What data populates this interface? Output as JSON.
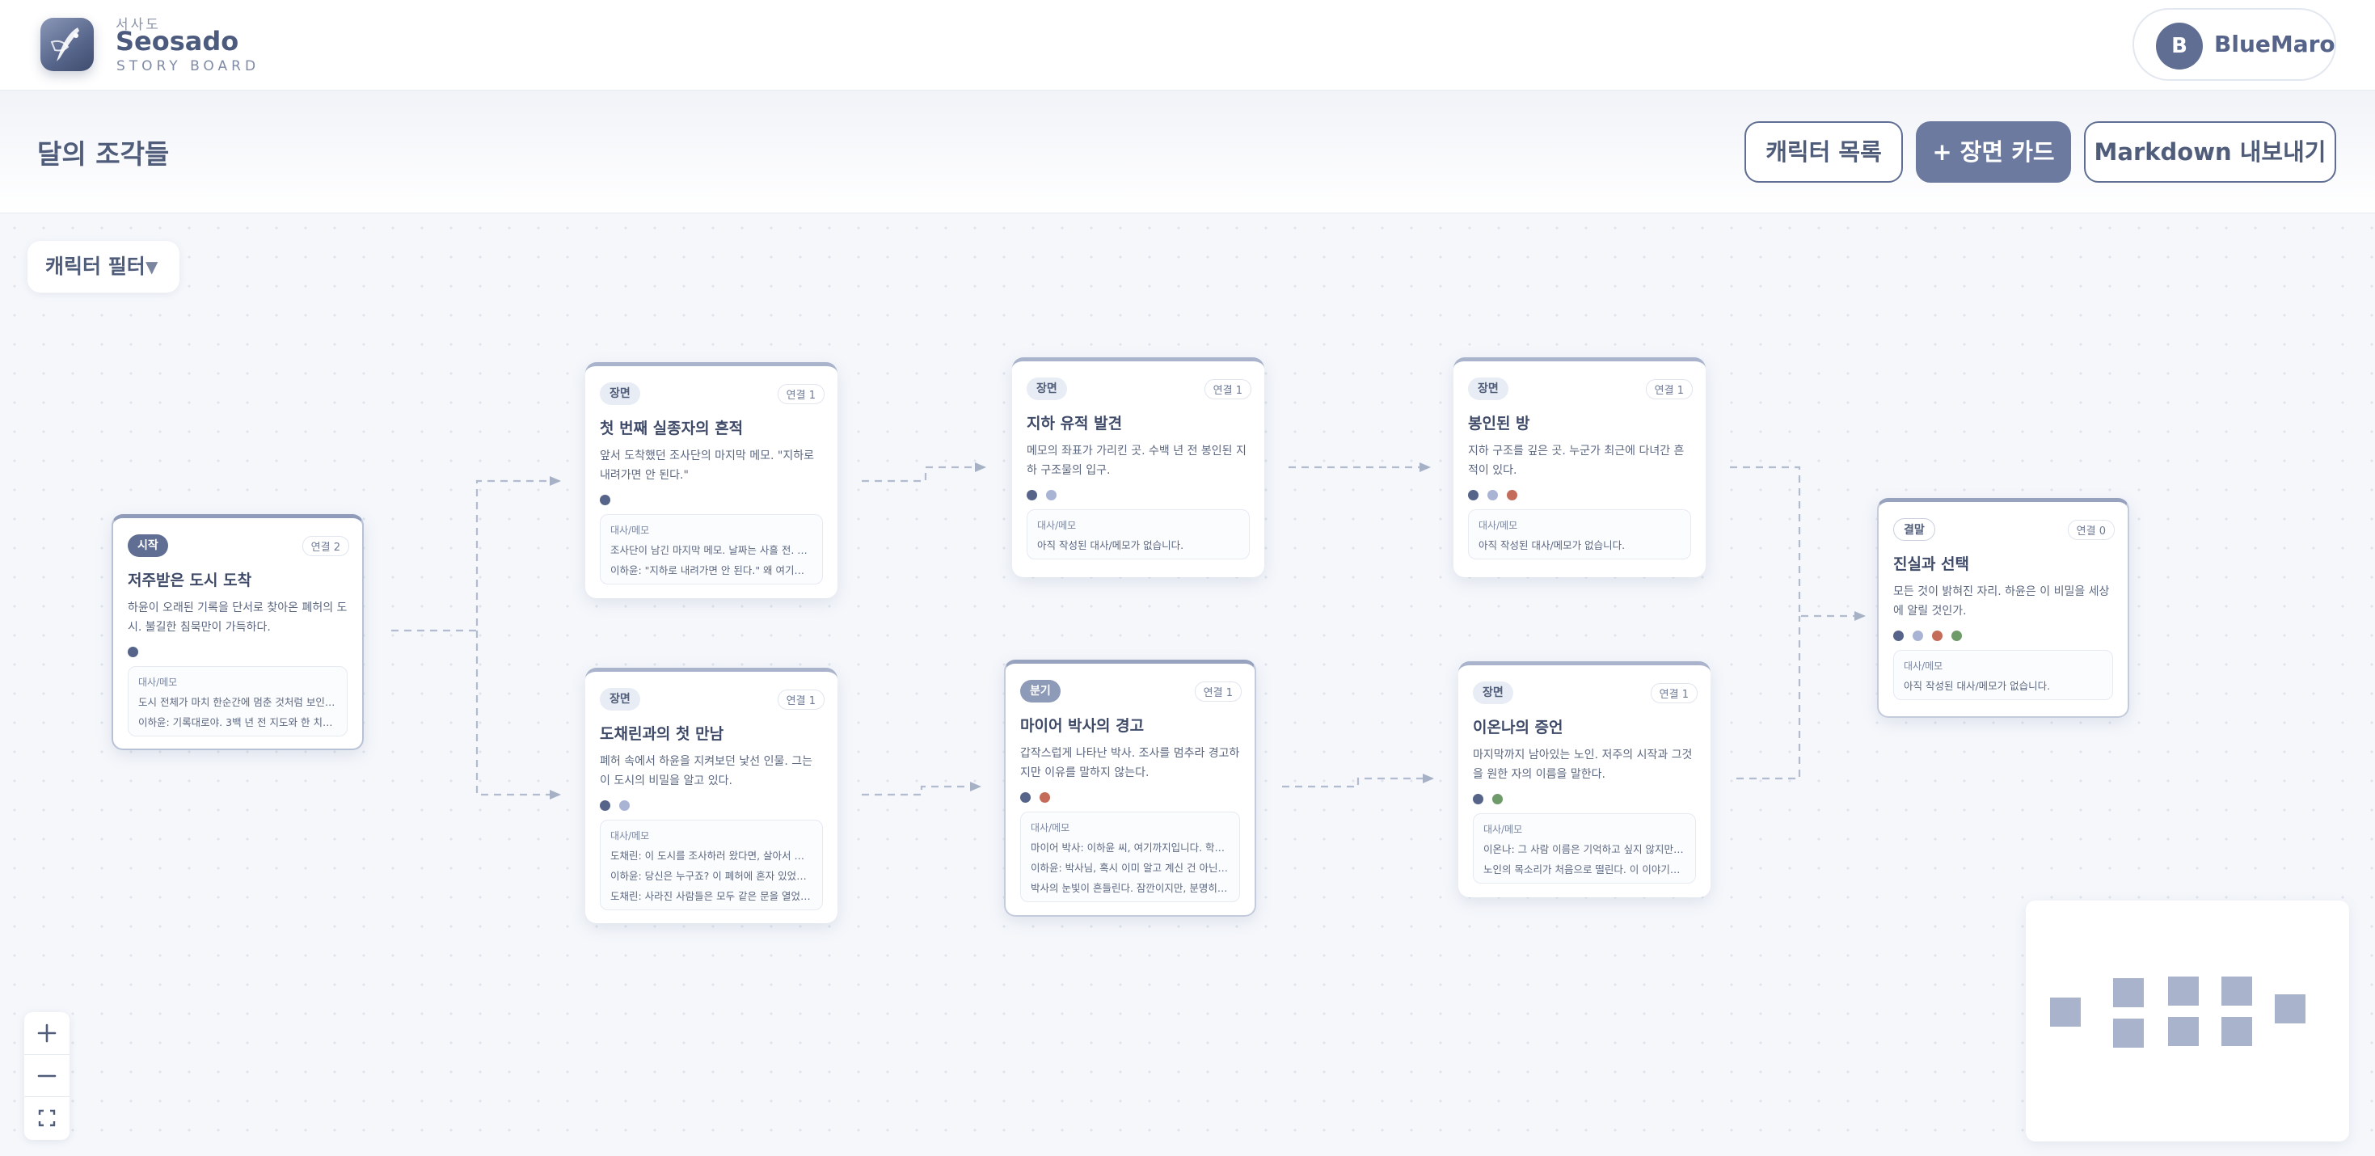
{
  "brand": {
    "subtitle": "서사도",
    "title": "Seosado",
    "tagline": "STORY BOARD",
    "logo_icon": "quill-feather-icon"
  },
  "user": {
    "initial": "B",
    "name": "BlueMaro"
  },
  "document": {
    "title": "달의 조각들"
  },
  "toolbar": {
    "characters_label": "캐릭터 목록",
    "add_scene_label": "+ 장면 카드",
    "export_label": "Markdown 내보내기"
  },
  "filter": {
    "label": "캐릭터 필터",
    "caret": "▼"
  },
  "colors": {
    "accent": "#6b7a9e",
    "char1": "#56648a",
    "char2": "#a9b4d4",
    "char3": "#c46b5a",
    "char4": "#6f9a6a"
  },
  "cards": [
    {
      "badge": "시작",
      "links": "연결 2",
      "title": "저주받은 도시 도착",
      "desc": "하윤이 오래된 기록을 단서로 찾아온 폐허의 도시. 불길한 침묵만이 가득하다.",
      "memo_label": "대사/메모",
      "memo": [
        "도시 전체가 마치 한순간에 멈춘 것처럼 보인다...",
        "이하윤: 기록대로야. 3백 년 전 지도와 한 치도 ..."
      ]
    },
    {
      "badge": "장면",
      "links": "연결 1",
      "title": "첫 번째 실종자의 흔적",
      "desc": "앞서 도착했던 조사단의 마지막 메모. \"지하로 내려가면 안 된다.\"",
      "memo_label": "대사/메모",
      "memo": [
        "조사단이 남긴 마지막 메모. 날짜는 사흘 전. 일...",
        "이하윤: \"지하로 내려가면 안 된다.\" 왜 여기서 ..."
      ]
    },
    {
      "badge": "장면",
      "links": "연결 1",
      "title": "도채린과의 첫 만남",
      "desc": "폐허 속에서 하윤을 지켜보던 낯선 인물. 그는 이 도시의 비밀을 알고 있다.",
      "memo_label": "대사/메모",
      "memo": [
        "도채린: 이 도시를 조사하러 왔다면, 살아서 돌...",
        "이하윤: 당신은 누구죠? 이 폐허에 혼자 있었던 ...",
        "도채린: 사라진 사람들은 모두 같은 문을 열었습..."
      ]
    },
    {
      "badge": "장면",
      "links": "연결 1",
      "title": "지하 유적 발견",
      "desc": "메모의 좌표가 가리킨 곳. 수백 년 전 봉인된 지하 구조물의 입구.",
      "memo_label": "대사/메모",
      "memo": [
        "아직 작성된 대사/메모가 없습니다."
      ]
    },
    {
      "badge": "분기",
      "links": "연결 1",
      "title": "마이어 박사의 경고",
      "desc": "갑작스럽게 나타난 박사. 조사를 멈추라 경고하지만 이유를 말하지 않는다.",
      "memo_label": "대사/메모",
      "memo": [
        "마이어 박사: 이하윤 씨, 여기까지입니다. 학술...",
        "이하윤: 박사님, 혹시 이미 알고 계신 건 아닌가...",
        "박사의 눈빛이 흔들린다. 잠깐이지만, 분명히 보..."
      ]
    },
    {
      "badge": "장면",
      "links": "연결 1",
      "title": "봉인된 방",
      "desc": "지하 구조를 깊은 곳. 누군가 최근에 다녀간 흔적이 있다.",
      "memo_label": "대사/메모",
      "memo": [
        "아직 작성된 대사/메모가 없습니다."
      ]
    },
    {
      "badge": "장면",
      "links": "연결 1",
      "title": "이온나의 증언",
      "desc": "마지막까지 남아있는 노인. 저주의 시작과 그것을 원한 자의 이름을 말한다.",
      "memo_label": "대사/메모",
      "memo": [
        "이온나: 그 사람 이름은 기억하고 싶지 않지만, ...",
        "노인의 목소리가 처음으로 떨린다. 이 이야기를 ..."
      ]
    },
    {
      "badge": "결말",
      "links": "연결 0",
      "title": "진실과 선택",
      "desc": "모든 것이 밝혀진 자리. 하윤은 이 비밀을 세상에 알릴 것인가.",
      "memo_label": "대사/메모",
      "memo": [
        "아직 작성된 대사/메모가 없습니다."
      ]
    }
  ],
  "zoom": {
    "in_icon": "plus-icon",
    "out_icon": "minus-icon",
    "fit_icon": "fit-view-icon"
  }
}
